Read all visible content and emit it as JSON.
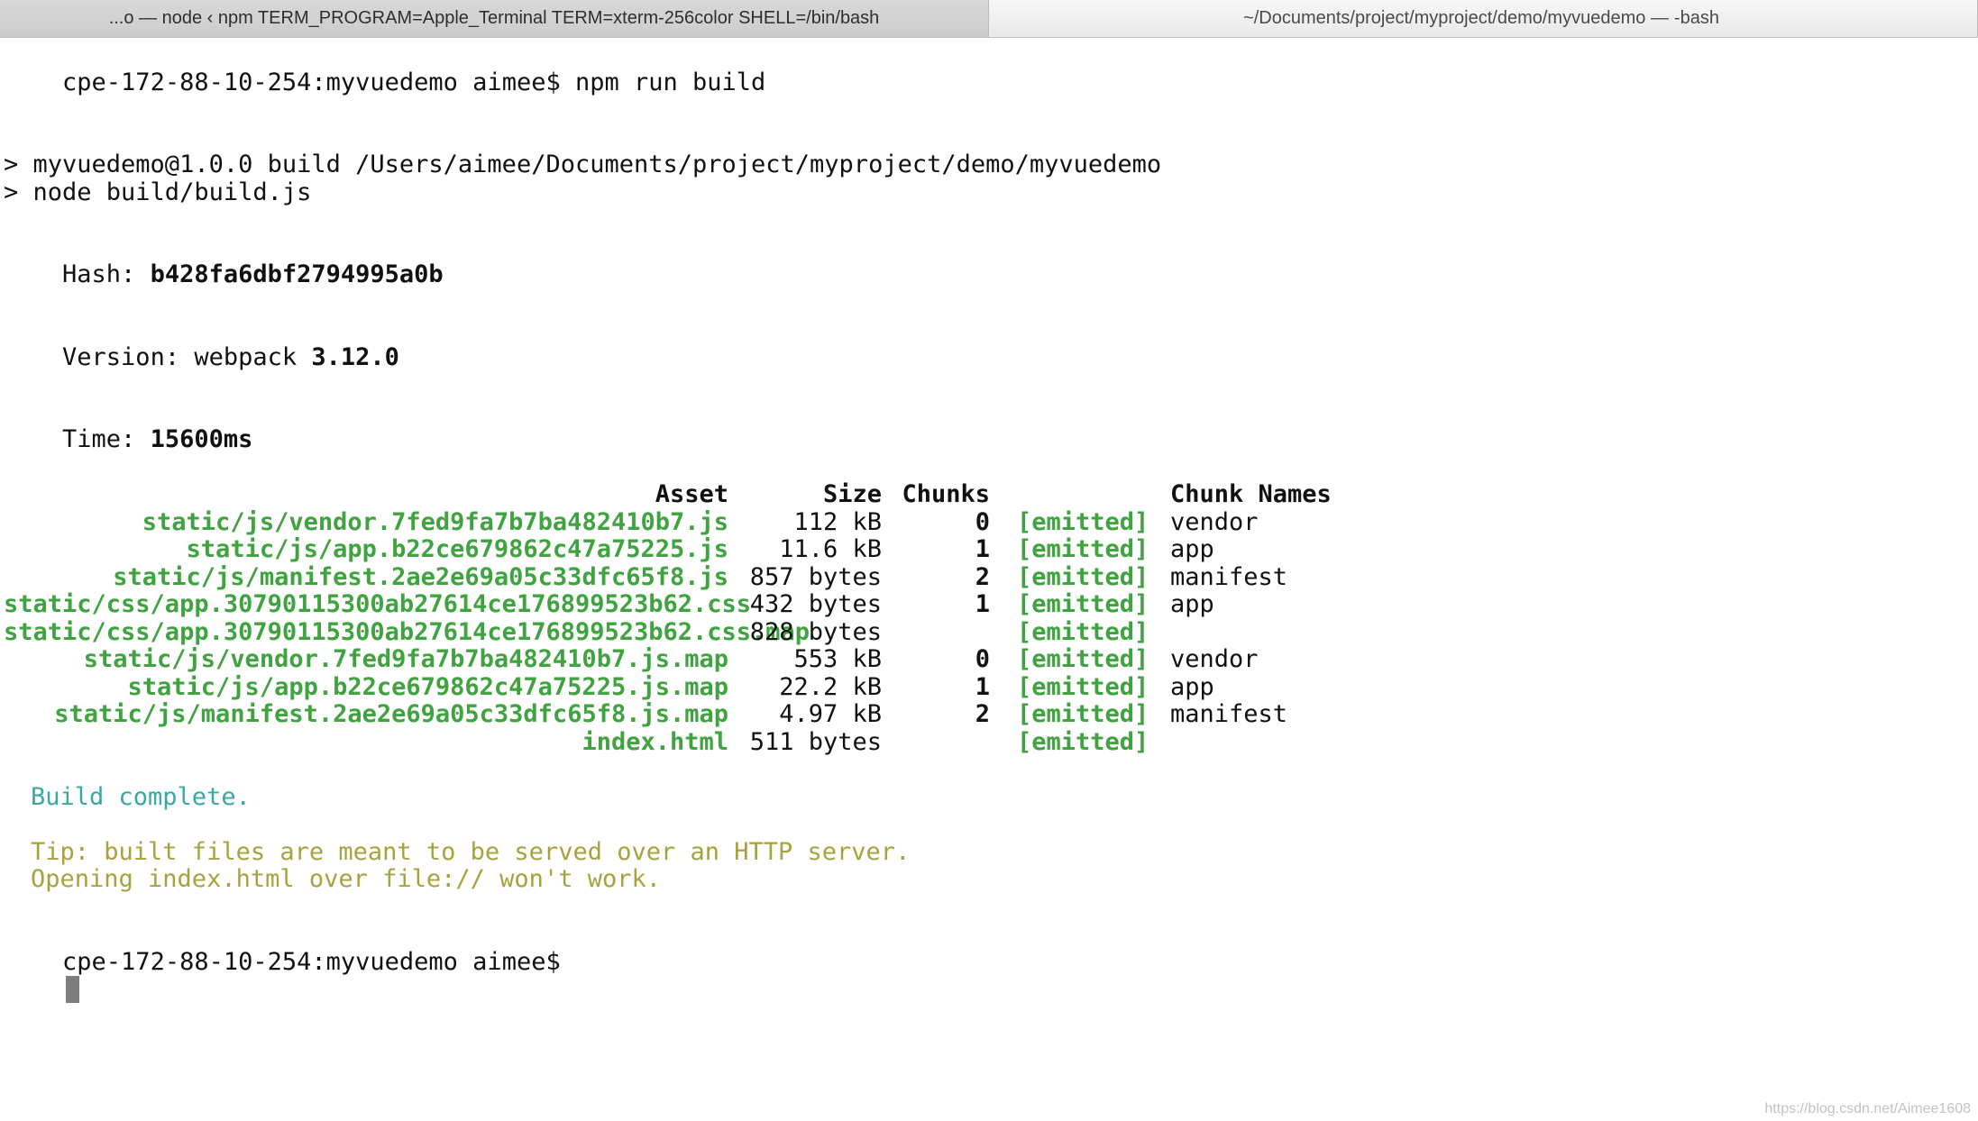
{
  "tabs": {
    "left": "...o — node ‹ npm TERM_PROGRAM=Apple_Terminal TERM=xterm-256color SHELL=/bin/bash",
    "right_path": "~/Documents/project/myproject/demo/myvuedemo —",
    "right_shell": "-bash"
  },
  "prompt1": "cpe-172-88-10-254:myvuedemo aimee$ ",
  "command": "npm run build",
  "script_lines": [
    "> myvuedemo@1.0.0 build /Users/aimee/Documents/project/myproject/demo/myvuedemo",
    "> node build/build.js"
  ],
  "stats": {
    "hash_label": "Hash: ",
    "hash_value": "b428fa6dbf2794995a0b",
    "version_label": "Version: webpack ",
    "version_value": "3.12.0",
    "time_label": "Time: ",
    "time_value": "15600ms"
  },
  "table": {
    "headers": {
      "asset": "Asset",
      "size": "Size",
      "chunks": "Chunks",
      "names": "Chunk Names"
    },
    "rows": [
      {
        "asset": "static/js/vendor.7fed9fa7b7ba482410b7.js",
        "size": "112 kB",
        "chunks": "0",
        "emit": "[emitted]",
        "name": "vendor"
      },
      {
        "asset": "static/js/app.b22ce679862c47a75225.js",
        "size": "11.6 kB",
        "chunks": "1",
        "emit": "[emitted]",
        "name": "app"
      },
      {
        "asset": "static/js/manifest.2ae2e69a05c33dfc65f8.js",
        "size": "857 bytes",
        "chunks": "2",
        "emit": "[emitted]",
        "name": "manifest"
      },
      {
        "asset": "static/css/app.30790115300ab27614ce176899523b62.css",
        "size": "432 bytes",
        "chunks": "1",
        "emit": "[emitted]",
        "name": "app"
      },
      {
        "asset": "static/css/app.30790115300ab27614ce176899523b62.css.map",
        "size": "828 bytes",
        "chunks": "",
        "emit": "[emitted]",
        "name": ""
      },
      {
        "asset": "static/js/vendor.7fed9fa7b7ba482410b7.js.map",
        "size": "553 kB",
        "chunks": "0",
        "emit": "[emitted]",
        "name": "vendor"
      },
      {
        "asset": "static/js/app.b22ce679862c47a75225.js.map",
        "size": "22.2 kB",
        "chunks": "1",
        "emit": "[emitted]",
        "name": "app"
      },
      {
        "asset": "static/js/manifest.2ae2e69a05c33dfc65f8.js.map",
        "size": "4.97 kB",
        "chunks": "2",
        "emit": "[emitted]",
        "name": "manifest"
      },
      {
        "asset": "index.html",
        "size": "511 bytes",
        "chunks": "",
        "emit": "[emitted]",
        "name": ""
      }
    ]
  },
  "done_msg": "Build complete.",
  "tip_lines": [
    "Tip: built files are meant to be served over an HTTP server.",
    "Opening index.html over file:// won't work."
  ],
  "prompt2": "cpe-172-88-10-254:myvuedemo aimee$",
  "watermark": "https://blog.csdn.net/Aimee1608"
}
